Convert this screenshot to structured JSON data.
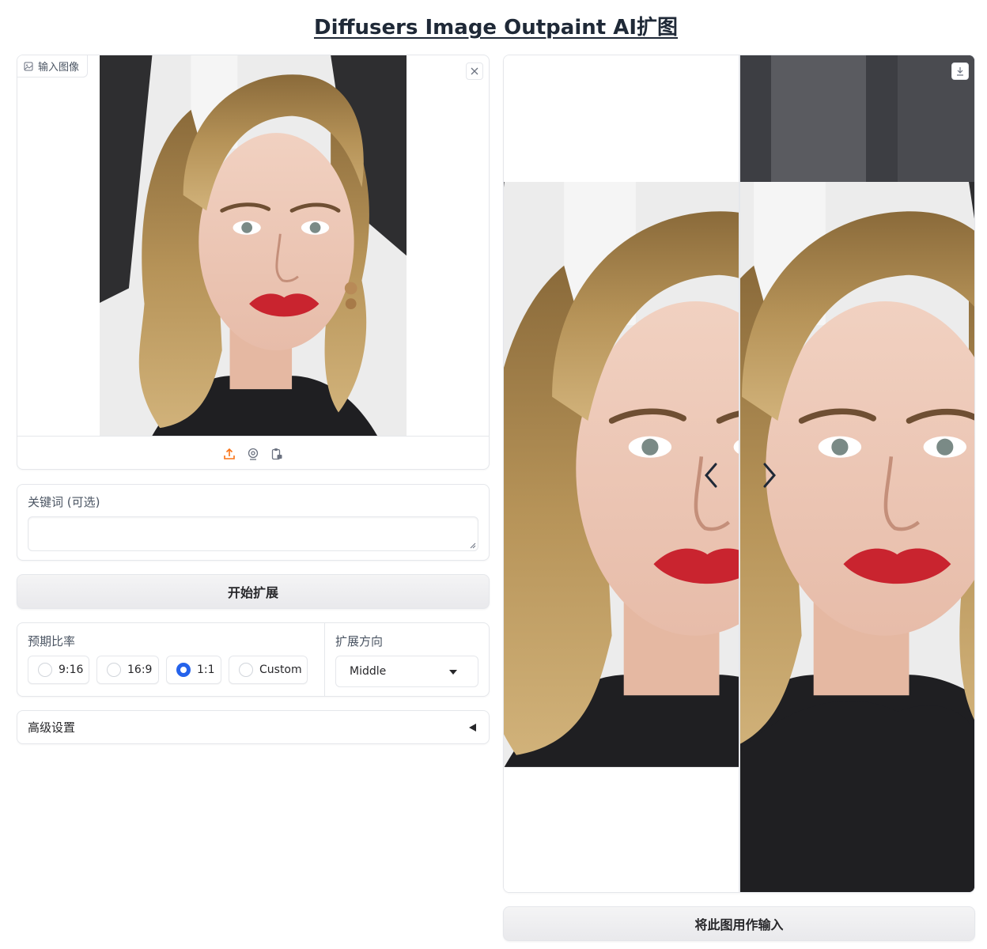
{
  "header": {
    "title": "Diffusers Image Outpaint AI扩图"
  },
  "input_image": {
    "label": "输入图像",
    "icons": {
      "label": "image-icon",
      "close": "close-icon",
      "upload": "upload-icon",
      "webcam": "webcam-icon",
      "clipboard": "clipboard-icon"
    }
  },
  "prompt": {
    "label": "关键词 (可选)",
    "value": "",
    "placeholder": ""
  },
  "generate_button": {
    "label": "开始扩展"
  },
  "ratio": {
    "label": "预期比率",
    "options": [
      {
        "label": "9:16",
        "checked": false
      },
      {
        "label": "16:9",
        "checked": false
      },
      {
        "label": "1:1",
        "checked": true
      },
      {
        "label": "Custom",
        "checked": false
      }
    ]
  },
  "alignment": {
    "label": "扩展方向",
    "selected": "Middle"
  },
  "advanced": {
    "label": "高级设置"
  },
  "result": {
    "icons": {
      "download": "download-icon",
      "left": "chevron-left-icon",
      "right": "chevron-right-icon"
    }
  },
  "use_as_input_button": {
    "label": "将此图用作输入"
  },
  "colors": {
    "accent": "#2563eb",
    "upload": "#f97316",
    "lipstick": "#c9242f",
    "hair": "#b08a4a"
  }
}
